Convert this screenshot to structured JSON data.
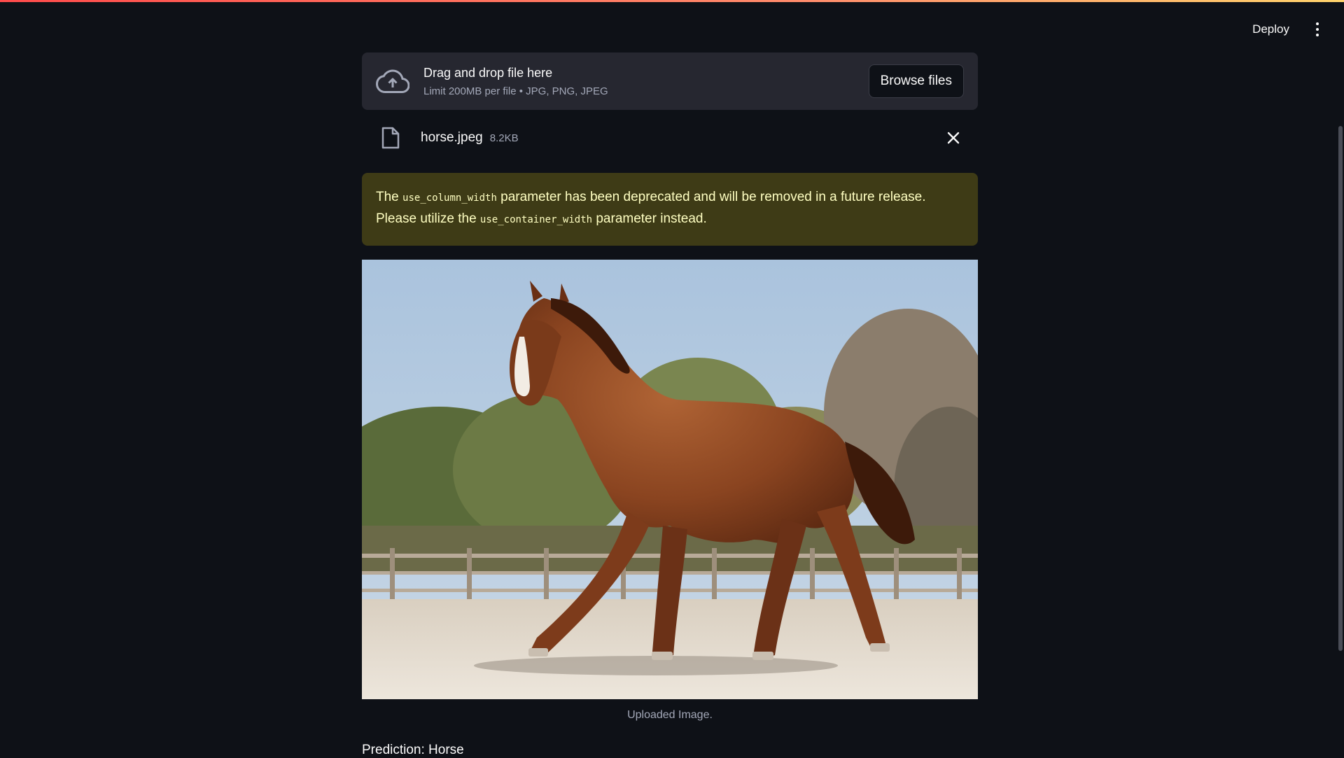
{
  "header": {
    "deploy_label": "Deploy"
  },
  "uploader": {
    "title": "Drag and drop file here",
    "limit": "Limit 200MB per file • JPG, PNG, JPEG",
    "browse_label": "Browse files"
  },
  "file": {
    "name": "horse.jpeg",
    "size": "8.2KB"
  },
  "warning": {
    "part1": "The ",
    "code1": "use_column_width",
    "part2": " parameter has been deprecated and will be removed in a future release. Please utilize the ",
    "code2": "use_container_width",
    "part3": " parameter instead."
  },
  "image": {
    "caption": "Uploaded Image."
  },
  "prediction": "Prediction: Horse",
  "colors": {
    "background": "#0e1117",
    "dropzone": "#262730",
    "warning_bg": "#3e3b16",
    "warning_text": "#ffffc2"
  }
}
